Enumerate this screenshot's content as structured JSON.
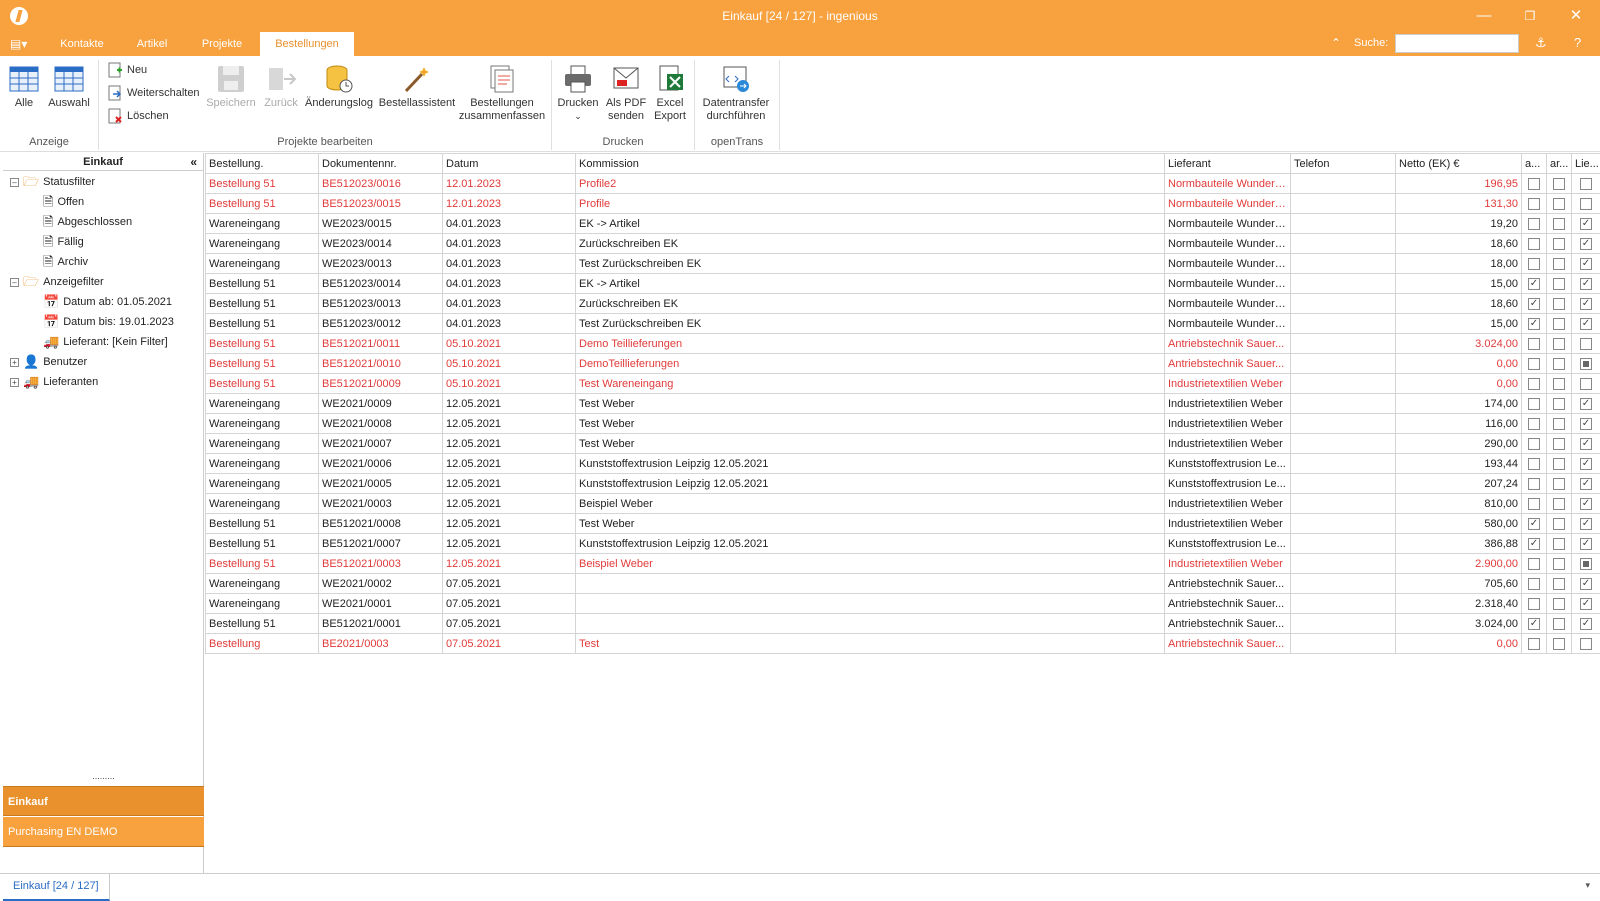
{
  "window": {
    "title": "Einkauf [24 / 127] - ingenious"
  },
  "ribbon_tabs": [
    "Kontakte",
    "Artikel",
    "Projekte",
    "Bestellungen"
  ],
  "active_tab": "Bestellungen",
  "search": {
    "label": "Suche:",
    "value": ""
  },
  "ribbon": {
    "anzeige": {
      "label": "Anzeige",
      "alle": "Alle",
      "auswahl": "Auswahl"
    },
    "bearbeiten": {
      "label": "Projekte bearbeiten",
      "neu": "Neu",
      "weiterschalten": "Weiterschalten",
      "loeschen": "Löschen",
      "speichern": "Speichern",
      "zurueck": "Zurück",
      "aenderungslog": "Änderungslog",
      "bestellassistent": "Bestellassistent",
      "zusammenfassen": "Bestellungen zusammenfassen"
    },
    "drucken": {
      "label": "Drucken",
      "drucken": "Drucken",
      "pdf": "Als PDF senden",
      "excel": "Excel Export"
    },
    "opentrans": {
      "label": "openTrans",
      "datentransfer": "Datentransfer durchführen"
    }
  },
  "nav": {
    "title": "Einkauf",
    "statusfilter": "Statusfilter",
    "offen": "Offen",
    "abgeschlossen": "Abgeschlossen",
    "faellig": "Fällig",
    "archiv": "Archiv",
    "anzeigefilter": "Anzeigefilter",
    "datum_ab": "Datum ab: 01.05.2021",
    "datum_bis": "Datum bis: 19.01.2023",
    "lieferant": "Lieferant: [Kein Filter]",
    "benutzer": "Benutzer",
    "lieferanten": "Lieferanten",
    "section1": "Einkauf",
    "section2": "Purchasing EN DEMO",
    "splitter": "........."
  },
  "table": {
    "headers": [
      "Bestellung.",
      "Dokumentennr.",
      "Datum",
      "Kommission",
      "Lieferant",
      "Telefon",
      "Netto (EK) €",
      "a...",
      "ar...",
      "Lie..."
    ],
    "rows": [
      {
        "red": true,
        "c": [
          "Bestellung 51",
          "BE512023/0016",
          "12.01.2023",
          "Profile2",
          "Normbauteile Wunderli...",
          "",
          "196,95"
        ],
        "cb": [
          0,
          0,
          0
        ]
      },
      {
        "red": true,
        "c": [
          "Bestellung 51",
          "BE512023/0015",
          "12.01.2023",
          "Profile",
          "Normbauteile Wunderli...",
          "",
          "131,30"
        ],
        "cb": [
          0,
          0,
          0
        ]
      },
      {
        "red": false,
        "c": [
          "Wareneingang",
          "WE2023/0015",
          "04.01.2023",
          "EK -> Artikel",
          "Normbauteile Wunderli...",
          "",
          "19,20"
        ],
        "cb": [
          0,
          0,
          1
        ]
      },
      {
        "red": false,
        "c": [
          "Wareneingang",
          "WE2023/0014",
          "04.01.2023",
          "Zurückschreiben EK",
          "Normbauteile Wunderli...",
          "",
          "18,60"
        ],
        "cb": [
          0,
          0,
          1
        ]
      },
      {
        "red": false,
        "c": [
          "Wareneingang",
          "WE2023/0013",
          "04.01.2023",
          "Test Zurückschreiben EK",
          "Normbauteile Wunderli...",
          "",
          "18,00"
        ],
        "cb": [
          0,
          0,
          1
        ]
      },
      {
        "red": false,
        "c": [
          "Bestellung 51",
          "BE512023/0014",
          "04.01.2023",
          "EK -> Artikel",
          "Normbauteile Wunderli...",
          "",
          "15,00"
        ],
        "cb": [
          1,
          0,
          1
        ]
      },
      {
        "red": false,
        "c": [
          "Bestellung 51",
          "BE512023/0013",
          "04.01.2023",
          "Zurückschreiben EK",
          "Normbauteile Wunderli...",
          "",
          "18,60"
        ],
        "cb": [
          1,
          0,
          1
        ]
      },
      {
        "red": false,
        "c": [
          "Bestellung 51",
          "BE512023/0012",
          "04.01.2023",
          "Test Zurückschreiben EK",
          "Normbauteile Wunderli...",
          "",
          "15,00"
        ],
        "cb": [
          1,
          0,
          1
        ]
      },
      {
        "red": true,
        "c": [
          "Bestellung 51",
          "BE512021/0011",
          "05.10.2021",
          "Demo Teillieferungen",
          "Antriebstechnik Sauer...",
          "",
          "3.024,00"
        ],
        "cb": [
          0,
          0,
          0
        ]
      },
      {
        "red": true,
        "c": [
          "Bestellung 51",
          "BE512021/0010",
          "05.10.2021",
          "DemoTeillieferungen",
          "Antriebstechnik Sauer...",
          "",
          "0,00"
        ],
        "cb": [
          0,
          0,
          2
        ]
      },
      {
        "red": true,
        "c": [
          "Bestellung 51",
          "BE512021/0009",
          "05.10.2021",
          "Test Wareneingang",
          "Industrietextilien Weber",
          "",
          "0,00"
        ],
        "cb": [
          0,
          0,
          0
        ]
      },
      {
        "red": false,
        "c": [
          "Wareneingang",
          "WE2021/0009",
          "12.05.2021",
          "Test Weber",
          "Industrietextilien Weber",
          "",
          "174,00"
        ],
        "cb": [
          0,
          0,
          1
        ]
      },
      {
        "red": false,
        "c": [
          "Wareneingang",
          "WE2021/0008",
          "12.05.2021",
          "Test Weber",
          "Industrietextilien Weber",
          "",
          "116,00"
        ],
        "cb": [
          0,
          0,
          1
        ]
      },
      {
        "red": false,
        "c": [
          "Wareneingang",
          "WE2021/0007",
          "12.05.2021",
          "Test Weber",
          "Industrietextilien Weber",
          "",
          "290,00"
        ],
        "cb": [
          0,
          0,
          1
        ]
      },
      {
        "red": false,
        "c": [
          "Wareneingang",
          "WE2021/0006",
          "12.05.2021",
          "Kunststoffextrusion Leipzig 12.05.2021",
          "Kunststoffextrusion Le...",
          "",
          "193,44"
        ],
        "cb": [
          0,
          0,
          1
        ]
      },
      {
        "red": false,
        "c": [
          "Wareneingang",
          "WE2021/0005",
          "12.05.2021",
          "Kunststoffextrusion Leipzig 12.05.2021",
          "Kunststoffextrusion Le...",
          "",
          "207,24"
        ],
        "cb": [
          0,
          0,
          1
        ]
      },
      {
        "red": false,
        "c": [
          "Wareneingang",
          "WE2021/0003",
          "12.05.2021",
          "Beispiel Weber",
          "Industrietextilien Weber",
          "",
          "810,00"
        ],
        "cb": [
          0,
          0,
          1
        ]
      },
      {
        "red": false,
        "c": [
          "Bestellung 51",
          "BE512021/0008",
          "12.05.2021",
          "Test Weber",
          "Industrietextilien Weber",
          "",
          "580,00"
        ],
        "cb": [
          1,
          0,
          1
        ]
      },
      {
        "red": false,
        "c": [
          "Bestellung 51",
          "BE512021/0007",
          "12.05.2021",
          "Kunststoffextrusion Leipzig 12.05.2021",
          "Kunststoffextrusion Le...",
          "",
          "386,88"
        ],
        "cb": [
          1,
          0,
          1
        ]
      },
      {
        "red": true,
        "c": [
          "Bestellung 51",
          "BE512021/0003",
          "12.05.2021",
          "Beispiel Weber",
          "Industrietextilien Weber",
          "",
          "2.900,00"
        ],
        "cb": [
          0,
          0,
          2
        ]
      },
      {
        "red": false,
        "c": [
          "Wareneingang",
          "WE2021/0002",
          "07.05.2021",
          "",
          "Antriebstechnik Sauer...",
          "",
          "705,60"
        ],
        "cb": [
          0,
          0,
          1
        ]
      },
      {
        "red": false,
        "c": [
          "Wareneingang",
          "WE2021/0001",
          "07.05.2021",
          "",
          "Antriebstechnik Sauer...",
          "",
          "2.318,40"
        ],
        "cb": [
          0,
          0,
          1
        ]
      },
      {
        "red": false,
        "c": [
          "Bestellung 51",
          "BE512021/0001",
          "07.05.2021",
          "",
          "Antriebstechnik Sauer...",
          "",
          "3.024,00"
        ],
        "cb": [
          1,
          0,
          1
        ]
      },
      {
        "red": true,
        "c": [
          "Bestellung",
          "BE2021/0003",
          "07.05.2021",
          "Test",
          "Antriebstechnik Sauer...",
          "",
          "0,00"
        ],
        "cb": [
          0,
          0,
          0
        ]
      }
    ]
  },
  "status_tab": "Einkauf [24 / 127]",
  "colors": {
    "accent": "#f7a13f",
    "accent_dark": "#e8912d",
    "red_row": "#e03a3a",
    "link": "#2b6cc4"
  },
  "icons": {
    "app": "logo-icon",
    "min": "minimize-icon",
    "max": "restore-icon",
    "close": "close-icon",
    "help": "help-icon"
  }
}
